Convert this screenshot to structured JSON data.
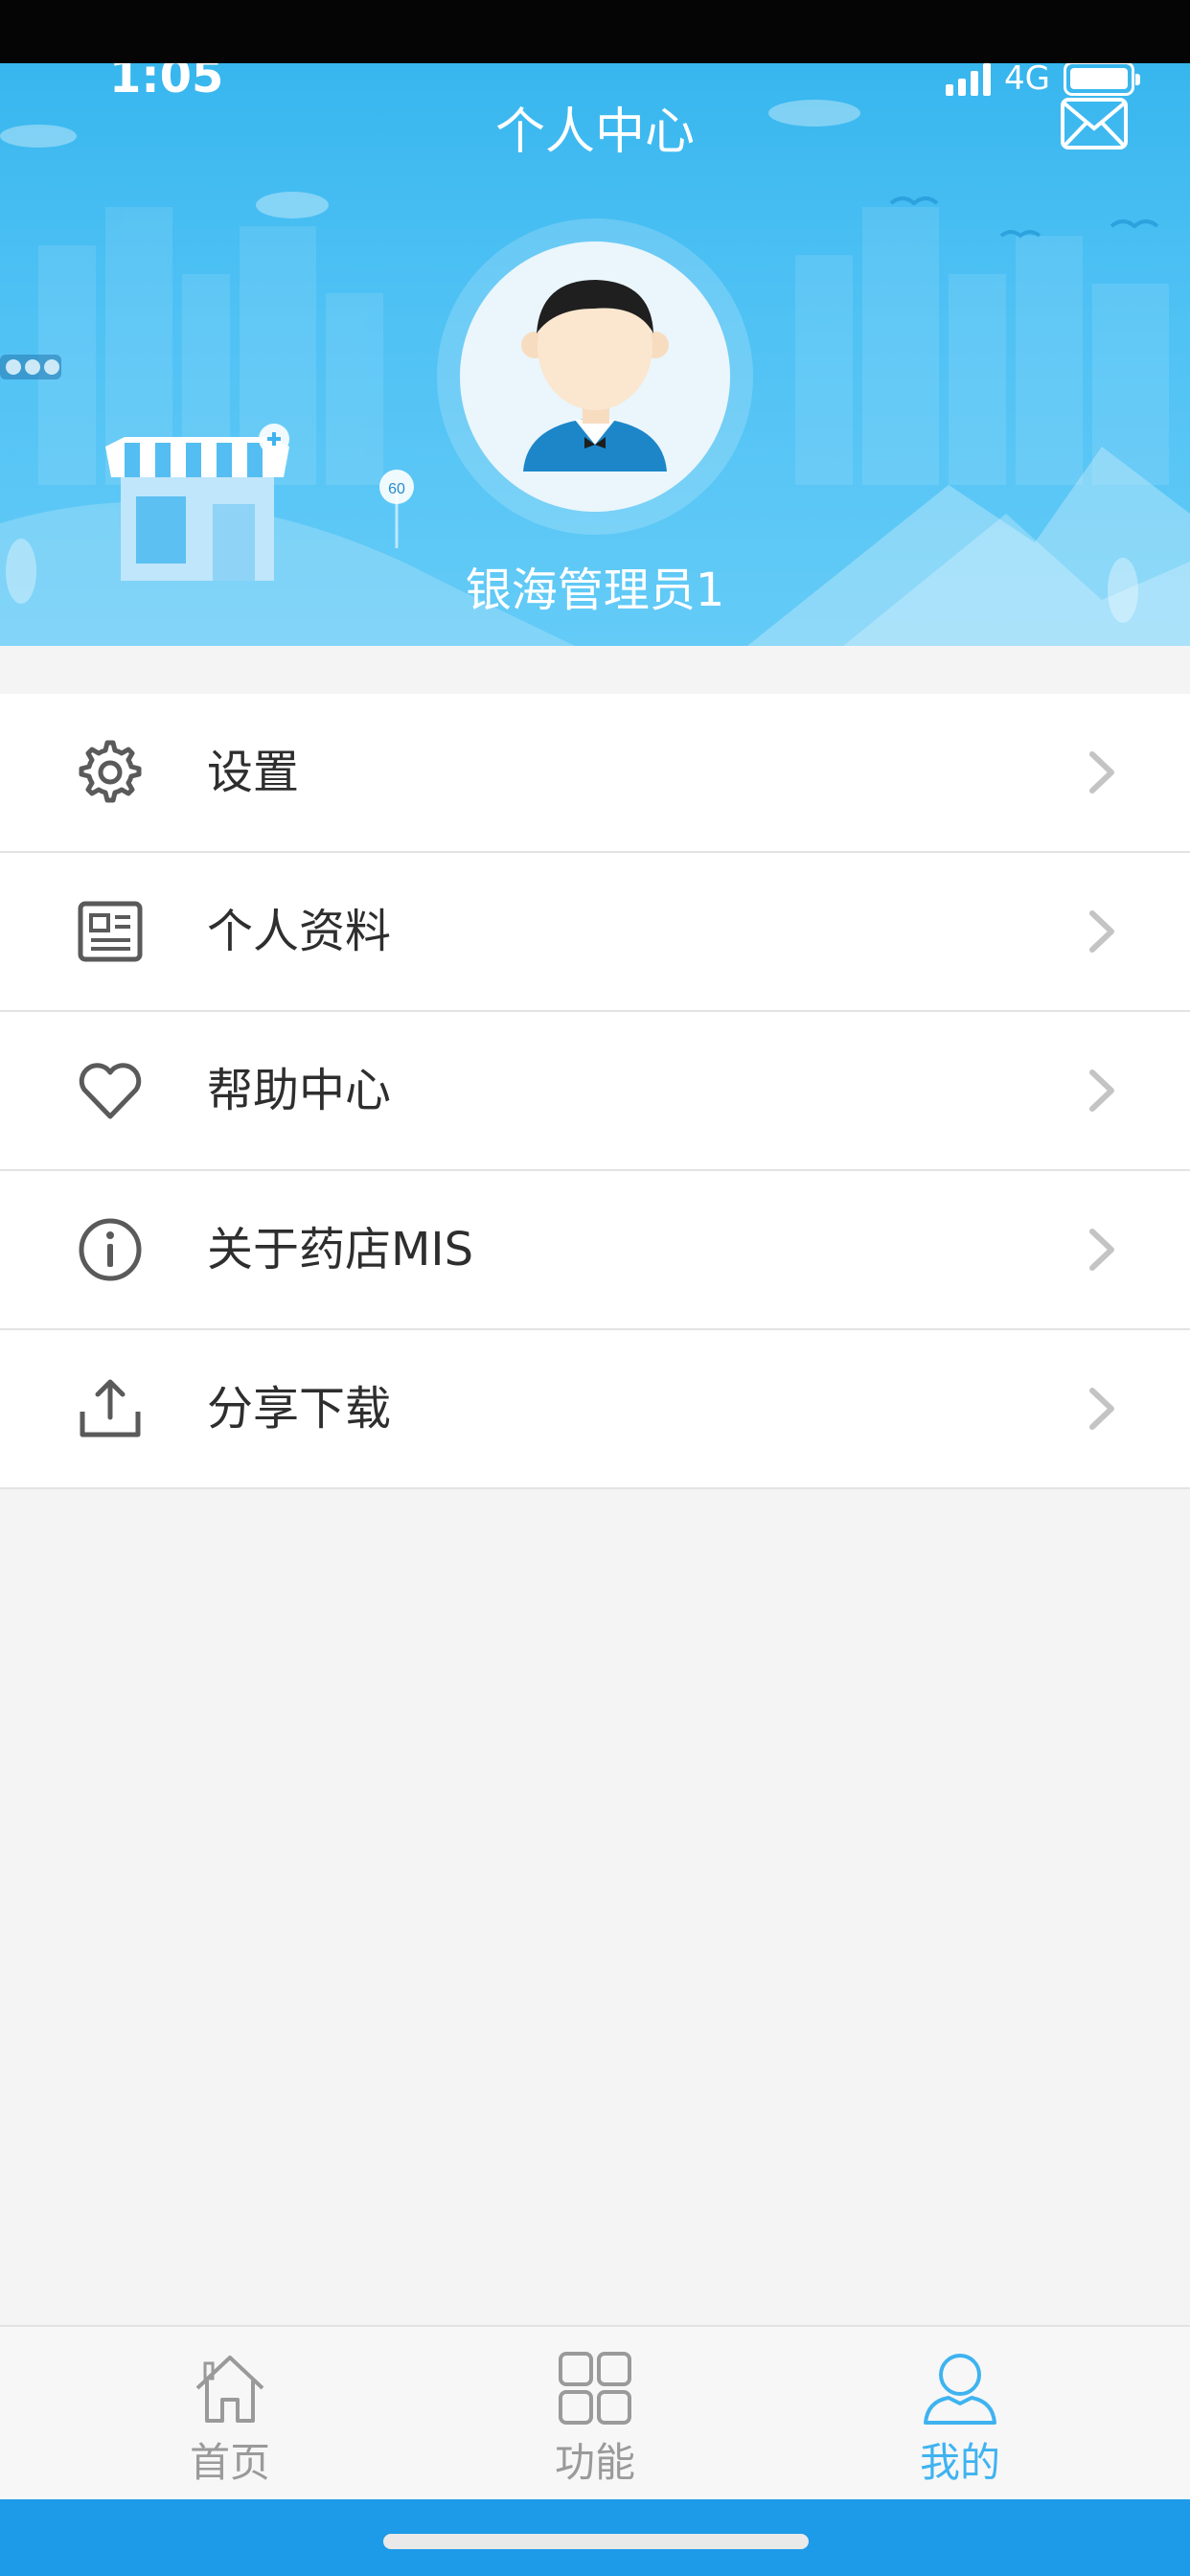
{
  "status_bar": {
    "time": "1:05",
    "network": "4G"
  },
  "header": {
    "title": "个人中心",
    "username": "银海管理员1",
    "sign_number": "60"
  },
  "menu": {
    "items": [
      {
        "label": "设置",
        "icon": "gear-icon"
      },
      {
        "label": "个人资料",
        "icon": "profile-card-icon"
      },
      {
        "label": "帮助中心",
        "icon": "heart-icon"
      },
      {
        "label": "关于药店MIS",
        "icon": "info-icon"
      },
      {
        "label": "分享下载",
        "icon": "share-upload-icon"
      }
    ]
  },
  "tabbar": {
    "tabs": [
      {
        "label": "首页",
        "icon": "home-icon",
        "active": false
      },
      {
        "label": "功能",
        "icon": "grid-icon",
        "active": false
      },
      {
        "label": "我的",
        "icon": "user-icon",
        "active": true
      }
    ]
  },
  "colors": {
    "header_blue": "#4ec1f4",
    "accent_blue": "#3fb3f0",
    "bottom_bar": "#1d9ae8",
    "text": "#2e2e2e",
    "inactive": "#9a9a9a"
  }
}
